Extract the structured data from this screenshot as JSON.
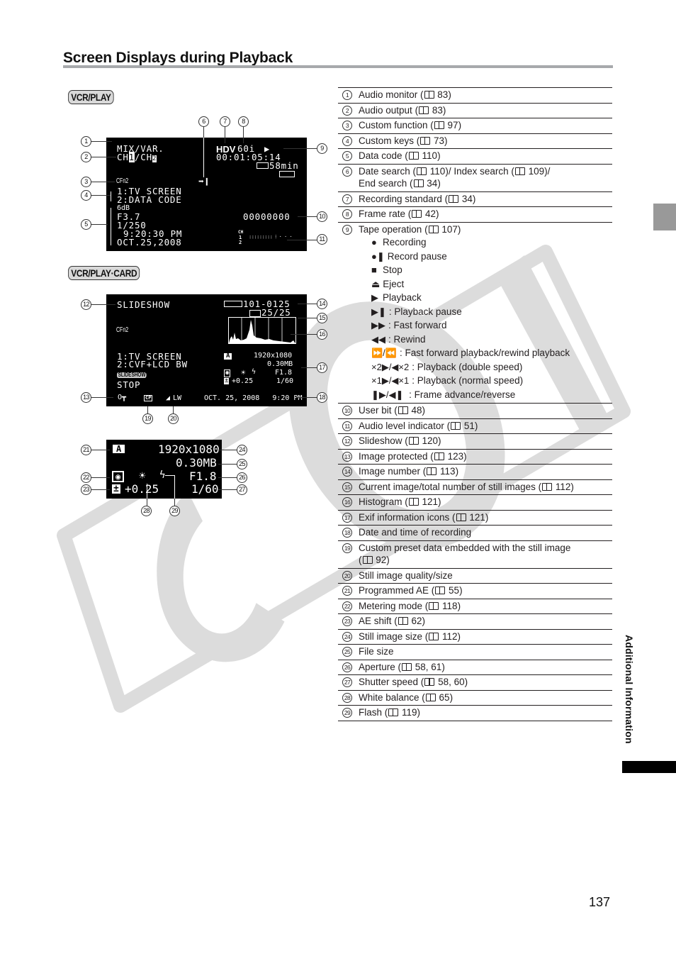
{
  "page": {
    "title": "Screen Displays during Playback",
    "page_number": "137",
    "side_label": "Additional Information",
    "watermark": "COPY"
  },
  "badges": {
    "vcr_play": "VCR/PLAY",
    "vcr_play_card": "VCR/PLAY·CARD"
  },
  "screen_tape": {
    "audio_monitor": "MIX/VAR.",
    "audio_output_a": "CH",
    "audio_output_ch1": "1",
    "audio_output_sep": "/CH",
    "audio_output_ch2": "2",
    "custom_function": "CFn2",
    "custom_key_1": "1:TV SCREEN",
    "custom_key_2": "2:DATA CODE",
    "gain": "6dB",
    "aperture": "F3.7",
    "shutter": "1/250",
    "time": "9:20:30 PM",
    "date": "OCT.25,2008",
    "recording_standard": "HDV",
    "frame_rate": "60i",
    "tape_operation_icon": "play-icon",
    "timecode": "00:01:05:14",
    "tape_remaining": "58min",
    "search_icon": "end-search-icon",
    "user_bit": "00000000",
    "audio_level_label": "CH",
    "audio_level_ch1": "1",
    "audio_level_ch2": "2"
  },
  "screen_card": {
    "slideshow": "SLIDESHOW",
    "custom_function": "CFn2",
    "custom_key_1": "1:TV SCREEN",
    "custom_key_2": "2:CVF+LCD BW",
    "slideshow_badge": "SLIDESHOW",
    "slideshow_state": "STOP",
    "image_number": "101-0125",
    "image_count": "25/25",
    "image_size": "1920x1080",
    "file_size": "0.30MB",
    "aperture": "F1.8",
    "shutter": "1/60",
    "ae_shift": "+0.25",
    "programmed_ae": "A",
    "date_time": "OCT. 25, 2008   9:20 PM",
    "quality": "LW",
    "custom_preset": "CP"
  },
  "screen_exif": {
    "programmed_ae": "A",
    "image_size": "1920x1080",
    "file_size": "0.30MB",
    "aperture": "F1.8",
    "shutter": "1/60",
    "ae_shift": "+0.25"
  },
  "callouts": [
    "1",
    "2",
    "3",
    "4",
    "5",
    "6",
    "7",
    "8",
    "9",
    "10",
    "11",
    "12",
    "13",
    "14",
    "15",
    "16",
    "17",
    "18",
    "19",
    "20",
    "21",
    "22",
    "23",
    "24",
    "25",
    "26",
    "27",
    "28",
    "29"
  ],
  "legend": [
    {
      "num": "1",
      "text": "Audio monitor (",
      "ref": "83)"
    },
    {
      "num": "2",
      "text": "Audio output (",
      "ref": "83)"
    },
    {
      "num": "3",
      "text": "Custom function (",
      "ref": "97)"
    },
    {
      "num": "4",
      "text": "Custom keys (",
      "ref": "73)"
    },
    {
      "num": "5",
      "text": "Data code (",
      "ref": "110)"
    },
    {
      "num": "6",
      "text": "Date search (",
      "ref": "110)/ Index search (",
      "ref2": "109)/",
      "line2": "End search (",
      "ref3": "34)"
    },
    {
      "num": "7",
      "text": "Recording standard (",
      "ref": "34)"
    },
    {
      "num": "8",
      "text": "Frame rate (",
      "ref": "42)"
    },
    {
      "num": "9",
      "text": "Tape operation (",
      "ref": "107)",
      "sub": [
        {
          "icon": "record-icon",
          "glyph": "●",
          "label": "Recording"
        },
        {
          "icon": "record-pause-icon",
          "glyph": "●❚",
          "label": "Record pause"
        },
        {
          "icon": "stop-icon",
          "glyph": "■",
          "label": "Stop"
        },
        {
          "icon": "eject-icon",
          "glyph": "⏏",
          "label": "Eject"
        },
        {
          "icon": "play-icon",
          "glyph": "▶",
          "label": "Playback"
        },
        {
          "icon": "play-pause-icon",
          "glyph": "▶❚",
          "label": ": Playback pause"
        },
        {
          "icon": "fast-forward-icon",
          "glyph": "▶▶",
          "label": ": Fast forward"
        },
        {
          "icon": "rewind-icon",
          "glyph": "◀◀",
          "label": ": Rewind"
        },
        {
          "icon": "ff-rew-playback-icon",
          "glyph": "⏩/⏪",
          "label": ": Fast forward playback/rewind playback"
        },
        {
          "icon": "double-speed-icon",
          "glyph": "×2▶/◀×2",
          "label": ": Playback (double speed)"
        },
        {
          "icon": "normal-speed-icon",
          "glyph": "×1▶/◀×1",
          "label": ": Playback (normal speed)"
        },
        {
          "icon": "frame-advance-icon",
          "glyph": "❚▶/◀❚",
          "label": " : Frame advance/reverse"
        }
      ]
    },
    {
      "num": "10",
      "text": "User bit (",
      "ref": "48)"
    },
    {
      "num": "11",
      "text": "Audio level indicator (",
      "ref": "51)"
    },
    {
      "num": "12",
      "text": "Slideshow (",
      "ref": "120)"
    },
    {
      "num": "13",
      "text": "Image protected (",
      "ref": "123)"
    },
    {
      "num": "14",
      "text": "Image number (",
      "ref": "113)"
    },
    {
      "num": "15",
      "text": "Current image/total number of still images (",
      "ref": "112)"
    },
    {
      "num": "16",
      "text": "Histogram (",
      "ref": "121)"
    },
    {
      "num": "17",
      "text": "Exif information icons (",
      "ref": "121)"
    },
    {
      "num": "18",
      "text": "Date and time of recording"
    },
    {
      "num": "19",
      "text": "Custom preset data embedded with the still image",
      "line2": "(",
      "ref3": "92)"
    },
    {
      "num": "20",
      "text": "Still image quality/size"
    },
    {
      "num": "21",
      "text": "Programmed AE (",
      "ref": "55)"
    },
    {
      "num": "22",
      "text": "Metering mode (",
      "ref": "118)"
    },
    {
      "num": "23",
      "text": "AE shift (",
      "ref": "62)"
    },
    {
      "num": "24",
      "text": "Still image size (",
      "ref": "112)"
    },
    {
      "num": "25",
      "text": "File size"
    },
    {
      "num": "26",
      "text": "Aperture (",
      "ref": "58, 61)"
    },
    {
      "num": "27",
      "text": "Shutter speed (",
      "ref": "58, 60)"
    },
    {
      "num": "28",
      "text": "White balance (",
      "ref": "65)"
    },
    {
      "num": "29",
      "text": "Flash (",
      "ref": "119)"
    }
  ]
}
